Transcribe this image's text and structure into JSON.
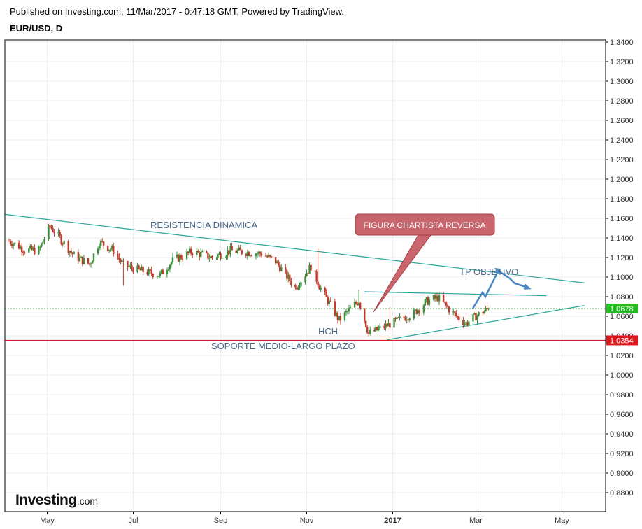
{
  "header": {
    "published": "Published on Investing.com, 11/Mar/2017 - 0:47:18 GMT, Powered by TradingView.",
    "symbol": "EUR/USD, D"
  },
  "logo": {
    "brand": "Investing",
    "domain": ".com"
  },
  "colors": {
    "up": "#3a8f3a",
    "down": "#c0392b",
    "trend": "#2aa59a",
    "support": "#d62020",
    "current_price_bg": "#1fbf1f",
    "support_price_bg": "#e0161d",
    "callout_bg": "#c9666d",
    "arrow": "#4a86c4"
  },
  "chart_data": {
    "type": "candlestick",
    "symbol": "EUR/USD",
    "interval": "D",
    "date_range": [
      "2016-04-04",
      "2017-03-10"
    ],
    "ylim": [
      0.87,
      1.345
    ],
    "x_ticks": [
      "May",
      "Jul",
      "Sep",
      "Nov",
      "2017",
      "Mar",
      "May"
    ],
    "y_ticks": [
      "1.3400",
      "1.3200",
      "1.3000",
      "1.2800",
      "1.2600",
      "1.2400",
      "1.2200",
      "1.2000",
      "1.1800",
      "1.1600",
      "1.1400",
      "1.1200",
      "1.1000",
      "1.0800",
      "1.0600",
      "1.0400",
      "1.0200",
      "1.0000",
      "0.9800",
      "0.9600",
      "0.9400",
      "0.9200",
      "0.9000",
      "0.8800"
    ],
    "current_price_label": "1.0678",
    "support_price_label": "1.0354",
    "closes": [
      {
        "date": "2016-04-04",
        "close": 1.137
      },
      {
        "date": "2016-04-15",
        "close": 1.128
      },
      {
        "date": "2016-04-25",
        "close": 1.127
      },
      {
        "date": "2016-05-03",
        "close": 1.152
      },
      {
        "date": "2016-05-10",
        "close": 1.14
      },
      {
        "date": "2016-05-20",
        "close": 1.122
      },
      {
        "date": "2016-05-31",
        "close": 1.113
      },
      {
        "date": "2016-06-07",
        "close": 1.136
      },
      {
        "date": "2016-06-17",
        "close": 1.127
      },
      {
        "date": "2016-06-24",
        "close": 1.112
      },
      {
        "date": "2016-07-05",
        "close": 1.107
      },
      {
        "date": "2016-07-20",
        "close": 1.102
      },
      {
        "date": "2016-07-29",
        "close": 1.117
      },
      {
        "date": "2016-08-12",
        "close": 1.126
      },
      {
        "date": "2016-08-26",
        "close": 1.12
      },
      {
        "date": "2016-09-08",
        "close": 1.127
      },
      {
        "date": "2016-09-30",
        "close": 1.124
      },
      {
        "date": "2016-10-10",
        "close": 1.116
      },
      {
        "date": "2016-10-24",
        "close": 1.089
      },
      {
        "date": "2016-11-04",
        "close": 1.111
      },
      {
        "date": "2016-11-10",
        "close": 1.091
      },
      {
        "date": "2016-11-24",
        "close": 1.056
      },
      {
        "date": "2016-12-08",
        "close": 1.076
      },
      {
        "date": "2016-12-15",
        "close": 1.042
      },
      {
        "date": "2016-12-30",
        "close": 1.052
      },
      {
        "date": "2017-01-16",
        "close": 1.063
      },
      {
        "date": "2017-01-25",
        "close": 1.075
      },
      {
        "date": "2017-02-02",
        "close": 1.079
      },
      {
        "date": "2017-02-15",
        "close": 1.06
      },
      {
        "date": "2017-02-22",
        "close": 1.053
      },
      {
        "date": "2017-03-03",
        "close": 1.062
      },
      {
        "date": "2017-03-10",
        "close": 1.0678
      }
    ],
    "drawings": {
      "resistance": [
        [
          "2016-04-01",
          1.164
        ],
        [
          "2017-05-17",
          1.094
        ]
      ],
      "support_horizontal": 1.0354,
      "neckline": [
        [
          "2016-12-12",
          1.085
        ],
        [
          "2017-04-20",
          1.081
        ]
      ],
      "rising_trendline": [
        [
          "2016-12-28",
          1.036
        ],
        [
          "2017-05-17",
          1.071
        ]
      ]
    },
    "annotations": {
      "resistance": "RESISTENCIA DINAMICA",
      "support": "SOPORTE MEDIO-LARGO PLAZO",
      "pattern": "HCH",
      "callout": "FIGURA CHARTISTA REVERSA",
      "target": "TP OBJETIVO"
    }
  }
}
